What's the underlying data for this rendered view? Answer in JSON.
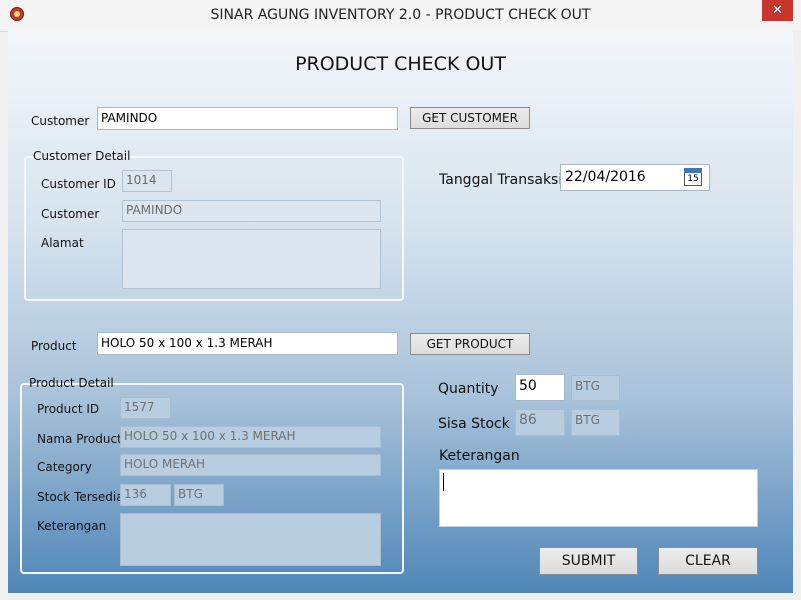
{
  "window": {
    "title": "SINAR AGUNG INVENTORY 2.0 - PRODUCT CHECK OUT",
    "close_glyph": "✕"
  },
  "heading": "PRODUCT CHECK OUT",
  "customer": {
    "label": "Customer",
    "value": "PAMINDO",
    "get_button": "GET CUSTOMER",
    "detail": {
      "group_title": "Customer Detail",
      "id_label": "Customer ID",
      "id_value": "1014",
      "name_label": "Customer",
      "name_value": "PAMINDO",
      "address_label": "Alamat",
      "address_value": ""
    }
  },
  "transaction": {
    "date_label": "Tanggal Transaksi",
    "date_value": "22/04/2016",
    "calendar_day": "15"
  },
  "product": {
    "label": "Product",
    "value": "HOLO 50 x 100 x 1.3 MERAH",
    "get_button": "GET PRODUCT",
    "detail": {
      "group_title": "Product Detail",
      "id_label": "Product ID",
      "id_value": "1577",
      "name_label": "Nama Product",
      "name_value": "HOLO 50 x 100 x 1.3 MERAH",
      "category_label": "Category",
      "category_value": "HOLO MERAH",
      "stock_label": "Stock Tersedia",
      "stock_value": "136",
      "stock_unit": "BTG",
      "note_label": "Keterangan",
      "note_value": ""
    }
  },
  "checkout": {
    "quantity_label": "Quantity",
    "quantity_value": "50",
    "quantity_unit": "BTG",
    "remaining_label": "Sisa Stock",
    "remaining_value": "86",
    "remaining_unit": "BTG",
    "note_label": "Keterangan",
    "note_value": "",
    "submit_label": "SUBMIT",
    "clear_label": "CLEAR"
  },
  "icons": {
    "app": "app-logo-icon",
    "close": "close-icon",
    "calendar": "calendar-icon"
  }
}
